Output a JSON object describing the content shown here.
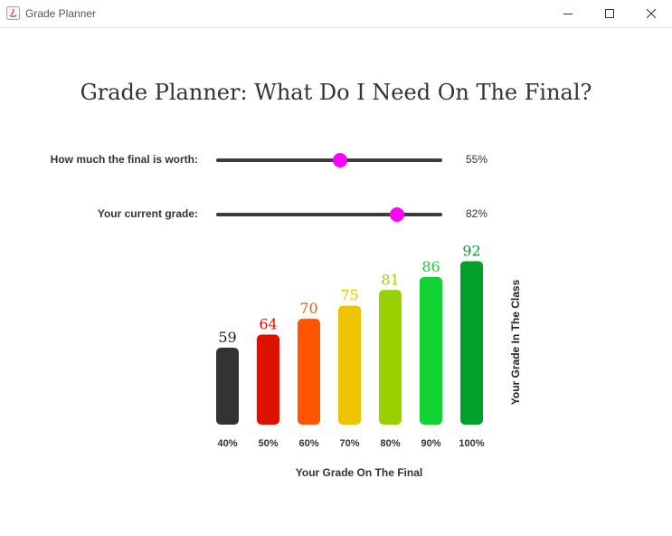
{
  "window": {
    "title": "Grade Planner"
  },
  "header": {
    "title": "Grade Planner: What Do I Need On The Final?"
  },
  "sliders": [
    {
      "label": "How much the final is worth:",
      "value_text": "55%",
      "fraction": 0.55
    },
    {
      "label": "Your current grade:",
      "value_text": "82%",
      "fraction": 0.82
    }
  ],
  "colors": {
    "thumb": "#ff00ff",
    "track": "#3c3c3c"
  },
  "chart_data": {
    "type": "bar",
    "categories": [
      "40%",
      "50%",
      "60%",
      "70%",
      "80%",
      "90%",
      "100%"
    ],
    "values": [
      59,
      64,
      70,
      75,
      81,
      86,
      92
    ],
    "value_labels": [
      "59",
      "64",
      "70",
      "75",
      "81",
      "86",
      "92"
    ],
    "colors": [
      "#333333",
      "#dd1100",
      "#ff5500",
      "#eec400",
      "#99d100",
      "#11d433",
      "#00a02a"
    ],
    "xlabel": "Your Grade On The Final",
    "ylabel": "Your Grade In The Class",
    "grid": false
  }
}
